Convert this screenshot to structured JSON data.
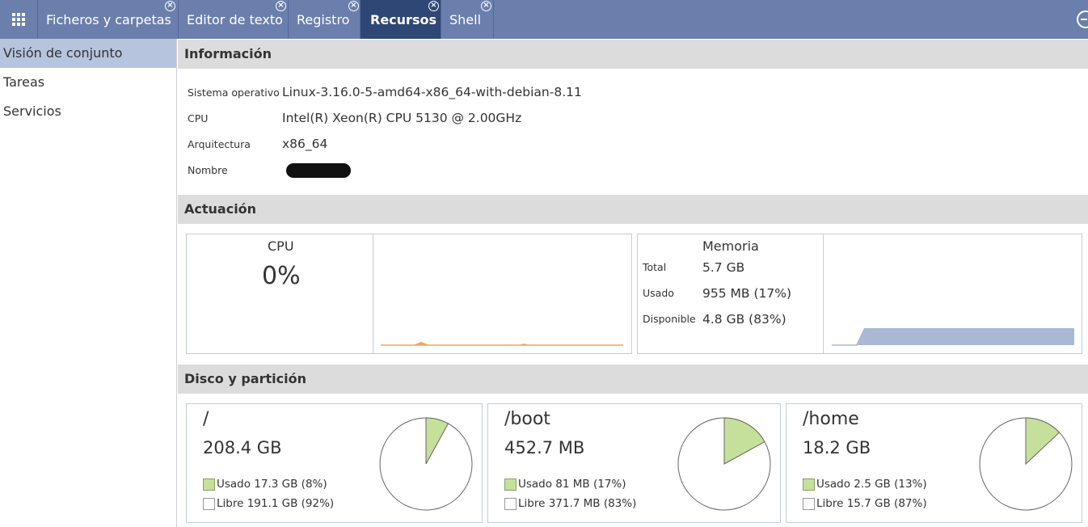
{
  "tabs": [
    {
      "label": "Ficheros y carpetas",
      "active": false
    },
    {
      "label": "Editor de texto",
      "active": false
    },
    {
      "label": "Registro",
      "active": false
    },
    {
      "label": "Recursos",
      "active": true
    },
    {
      "label": "Shell",
      "active": false
    }
  ],
  "sidebar": {
    "items": [
      {
        "label": "Visión de conjunto",
        "active": true
      },
      {
        "label": "Tareas",
        "active": false
      },
      {
        "label": "Servicios",
        "active": false
      }
    ]
  },
  "info": {
    "heading": "Información",
    "rows": [
      {
        "label": "Sistema operativo",
        "value": "Linux-3.16.0-5-amd64-x86_64-with-debian-8.11"
      },
      {
        "label": "CPU",
        "value": "Intel(R) Xeon(R) CPU 5130 @ 2.00GHz"
      },
      {
        "label": "Arquitectura",
        "value": "x86_64"
      },
      {
        "label": "Nombre",
        "value": ""
      }
    ]
  },
  "performance": {
    "heading": "Actuación",
    "cpu": {
      "title": "CPU",
      "value": "0%",
      "color": "#e8a860"
    },
    "memory": {
      "title": "Memoria",
      "total_label": "Total",
      "total_value": "5.7 GB",
      "used_label": "Usado",
      "used_value": "955 MB (17%)",
      "available_label": "Disponible",
      "available_value": "4.8 GB (83%)",
      "color": "#a9b8d4"
    }
  },
  "disks": {
    "heading": "Disco y partición",
    "items": [
      {
        "mount": "/",
        "size": "208.4 GB",
        "used": "Usado 17.3 GB (8%)",
        "free": "Libre 191.1 GB (92%)",
        "used_fraction": 0.08
      },
      {
        "mount": "/boot",
        "size": "452.7 MB",
        "used": "Usado 81 MB (17%)",
        "free": "Libre 371.7 MB (83%)",
        "used_fraction": 0.17
      },
      {
        "mount": "/home",
        "size": "18.2 GB",
        "used": "Usado 2.5 GB (13%)",
        "free": "Libre 15.7 GB (87%)",
        "used_fraction": 0.13
      }
    ],
    "used_color": "#c5e09a"
  }
}
